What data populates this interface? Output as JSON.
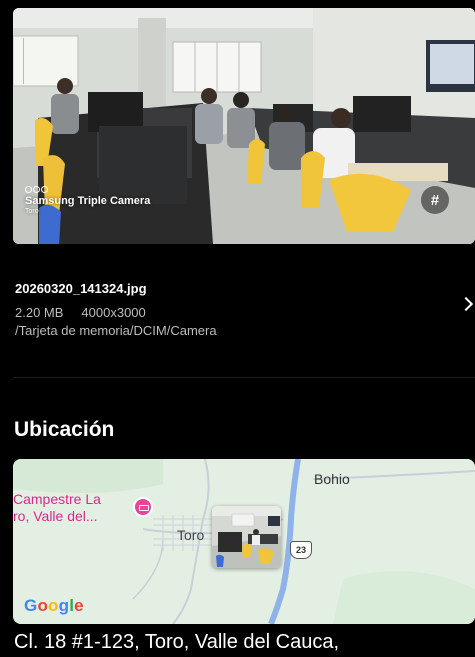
{
  "photo": {
    "camera_name": "Samsung Triple Camera",
    "camera_sub": "Toro",
    "tag_button": "#",
    "icon": "triple-camera-icon"
  },
  "file": {
    "name": "20260320_141324.jpg",
    "size": "2.20 MB",
    "resolution": "4000x3000",
    "path": "/Tarjeta de memoria/DCIM/Camera",
    "chevron_icon": "chevron-right-icon"
  },
  "location": {
    "title": "Ubicación",
    "map": {
      "label_campestre": "Campestre La ro, Valle del...",
      "label_campestre_line1": "Campestre La",
      "label_campestre_line2": "ro, Valle del...",
      "label_bohio": "Bohio",
      "label_toro": "Toro",
      "route_number": "23",
      "provider": "Google"
    },
    "address": "Cl. 18 #1-123, Toro, Valle del Cauca,"
  },
  "colors": {
    "background": "#000000",
    "secondary_text": "#bdbdbd",
    "map_land": "#e4efe4",
    "map_road": "#8fb2e8",
    "poi_pink": "#d52a8b"
  }
}
